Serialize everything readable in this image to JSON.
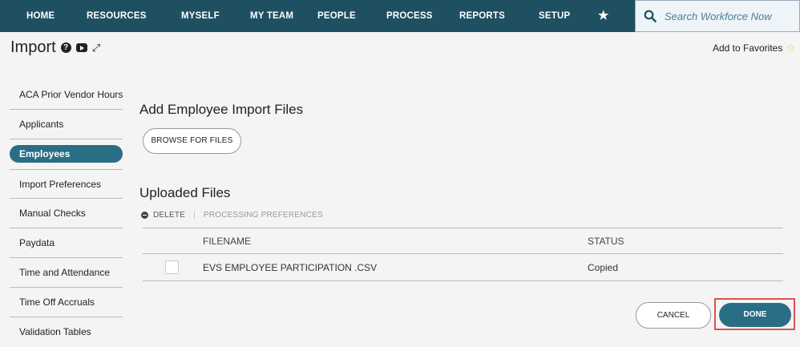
{
  "nav": {
    "items": [
      "HOME",
      "RESOURCES",
      "MYSELF",
      "MY TEAM",
      "PEOPLE",
      "PROCESS",
      "REPORTS",
      "SETUP"
    ],
    "favorites_icon": "star-icon",
    "search_placeholder": "Search Workforce Now"
  },
  "header": {
    "title": "Import",
    "favorites_label": "Add to Favorites"
  },
  "sidebar": {
    "items": [
      {
        "label": "ACA Prior Vendor Hours"
      },
      {
        "label": "Applicants"
      },
      {
        "label": "Employees",
        "active": true
      },
      {
        "label": "Import Preferences"
      },
      {
        "label": "Manual Checks"
      },
      {
        "label": "Paydata"
      },
      {
        "label": "Time and Attendance"
      },
      {
        "label": "Time Off Accruals"
      },
      {
        "label": "Validation Tables"
      }
    ]
  },
  "main": {
    "add_title": "Add Employee Import Files",
    "browse_label": "BROWSE FOR FILES",
    "uploaded_title": "Uploaded Files",
    "delete_label": "DELETE",
    "processing_label": "PROCESSING PREFERENCES",
    "table": {
      "headers": [
        "FILENAME",
        "STATUS"
      ],
      "rows": [
        {
          "filename": "EVS EMPLOYEE PARTICIPATION .CSV",
          "status": "Copied"
        }
      ]
    },
    "cancel_label": "CANCEL",
    "done_label": "DONE"
  },
  "colors": {
    "nav_bg": "#1e5061",
    "accent": "#2a6e85",
    "highlight": "#d9534f"
  }
}
